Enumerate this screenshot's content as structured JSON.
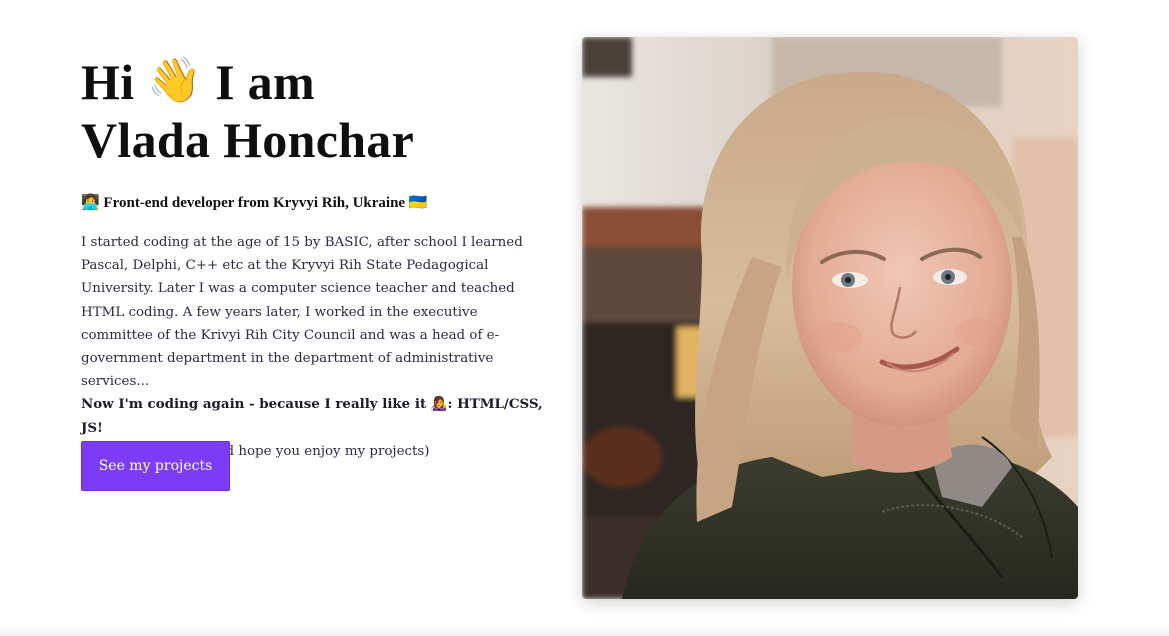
{
  "hero": {
    "heading_line1_start": "Hi",
    "heading_wave_emoji": "👋",
    "heading_line1_end": "I am",
    "heading_line2": "Vlada Honchar",
    "subtitle": "👩‍💻 Front-end developer from Kryvyi Rih, Ukraine 🇺🇦",
    "bio_paragraph": "I started coding at the age of 15 by BASIC, after school I learned Pascal, Delphi, C++ etc at the Kryvyi Rih State Pedagogical University. Later I was a computer science teacher and teached HTML coding. A few years later, I worked in the executive committee of the Krivyi Rih City Council and was a head of e-government department in the department of administrative services...",
    "bio_strong_line": "Now I'm coding again - because I really like it 👩‍🎤: HTML/CSS, JS!",
    "bio_closing": "I am open to work and hope you enjoy my projects)",
    "cta_label": "See my projects"
  },
  "photo": {
    "alt": "Vlada Honchar"
  },
  "colors": {
    "accent": "#7c3cf5",
    "text": "#0f0f0f",
    "body_text": "#2a2a44",
    "background": "#ffffff"
  }
}
